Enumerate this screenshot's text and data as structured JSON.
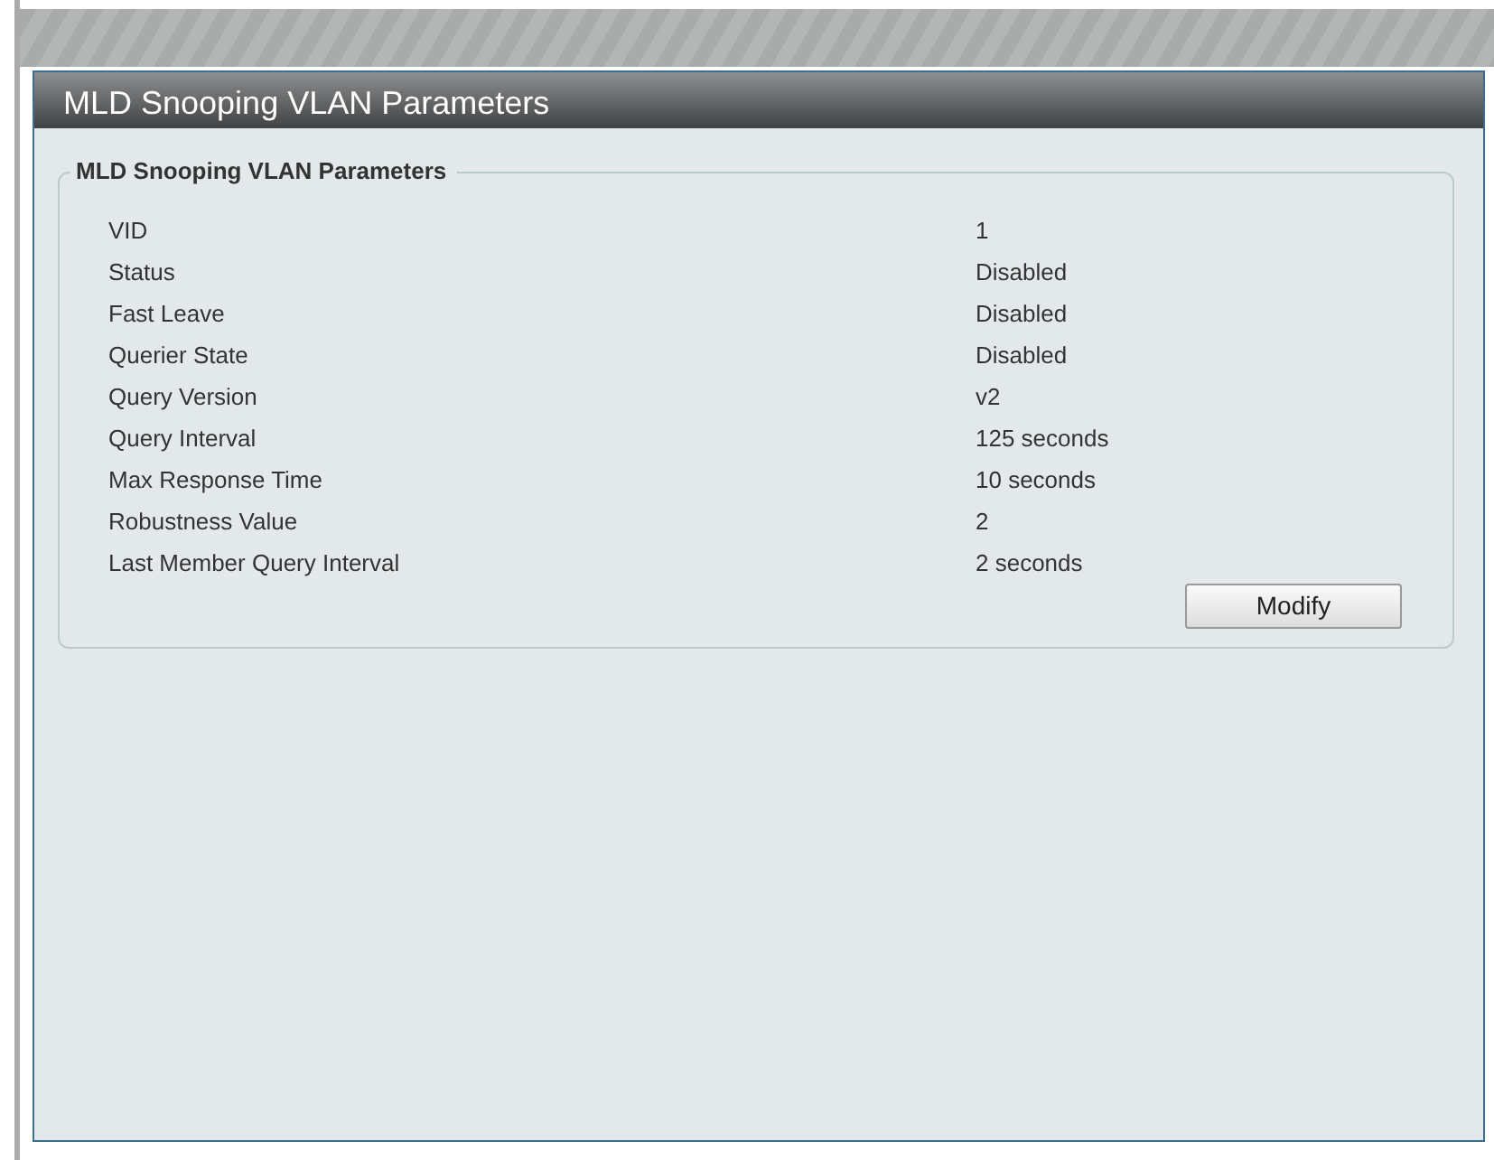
{
  "dialog": {
    "title": "MLD Snooping VLAN Parameters"
  },
  "fieldset": {
    "legend": "MLD Snooping VLAN Parameters",
    "rows": [
      {
        "label": "VID",
        "value": "1"
      },
      {
        "label": "Status",
        "value": "Disabled"
      },
      {
        "label": "Fast Leave",
        "value": "Disabled"
      },
      {
        "label": "Querier State",
        "value": "Disabled"
      },
      {
        "label": "Query Version",
        "value": "v2"
      },
      {
        "label": "Query Interval",
        "value": "125 seconds"
      },
      {
        "label": "Max Response Time",
        "value": "10 seconds"
      },
      {
        "label": "Robustness Value",
        "value": "2"
      },
      {
        "label": "Last Member Query Interval",
        "value": "2 seconds"
      }
    ],
    "button": "Modify"
  }
}
